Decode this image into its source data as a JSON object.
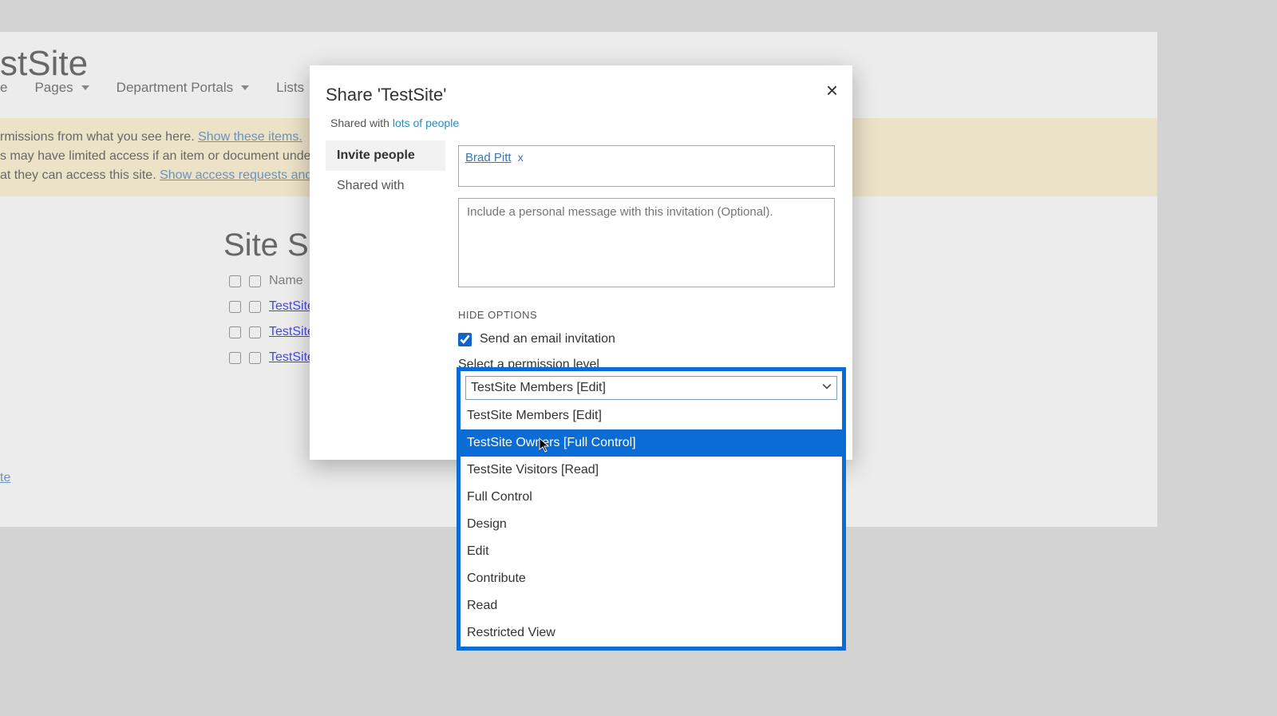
{
  "site": {
    "title": "stSite",
    "nav": [
      {
        "label": "e"
      },
      {
        "label": "Pages"
      },
      {
        "label": "Department Portals"
      },
      {
        "label": "Lists"
      }
    ],
    "notice_line1_prefix": "rmissions from what you see here.  ",
    "notice_link1": "Show these items.",
    "notice_line2": "s may have limited access if an item or document under the site",
    "notice_line3_prefix": "at they can access this site. ",
    "notice_link2": "Show access requests and invitation",
    "section_title": "Site Sett",
    "name_header": "Name",
    "groups": [
      "TestSite",
      "TestSite",
      "TestSite"
    ],
    "bottom_link": "te"
  },
  "modal": {
    "title": "Share 'TestSite'",
    "close": "×",
    "shared_prefix": "Shared with ",
    "shared_link": "lots of people",
    "tabs": {
      "invite": "Invite people",
      "shared": "Shared with"
    },
    "person_name": "Brad Pitt",
    "chip_x": "x",
    "msg_placeholder": "Include a personal message with this invitation (Optional).",
    "hide_options": "HIDE OPTIONS",
    "email_label": "Send an email invitation",
    "perm_label": "Select a permission level"
  },
  "dropdown": {
    "selected": "TestSite Members [Edit]",
    "options": [
      "TestSite Members [Edit]",
      "TestSite Owners [Full Control]",
      "TestSite Visitors [Read]",
      "Full Control",
      "Design",
      "Edit",
      "Contribute",
      "Read",
      "Restricted View"
    ],
    "hover_index": 1
  }
}
